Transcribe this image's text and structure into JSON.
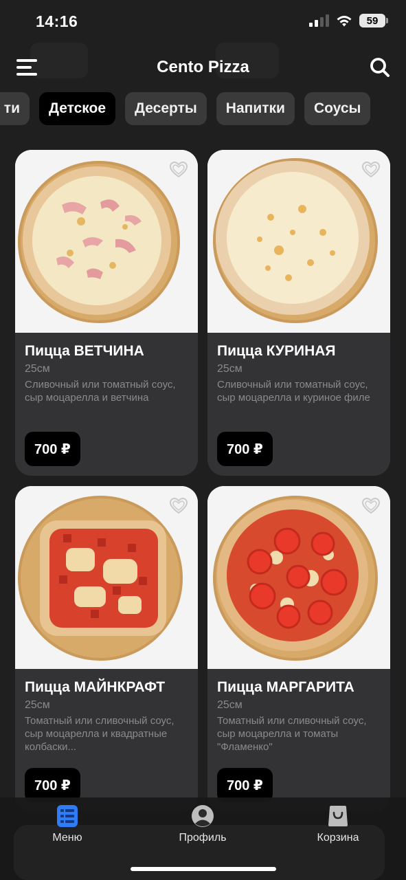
{
  "status": {
    "time": "14:16",
    "battery": "59"
  },
  "header": {
    "title": "Cento Pizza"
  },
  "categories": {
    "items": [
      {
        "label": "ти",
        "active": false
      },
      {
        "label": "Детское",
        "active": true
      },
      {
        "label": "Десерты",
        "active": false
      },
      {
        "label": "Напитки",
        "active": false
      },
      {
        "label": "Соусы",
        "active": false
      }
    ]
  },
  "products": [
    {
      "title": "Пицца ВЕТЧИНА",
      "size": "25см",
      "description": "Сливочный или томатный соус, сыр моцарелла и ветчина",
      "price": "700 ₽",
      "favorite": false,
      "image": "pizza-ham"
    },
    {
      "title": "Пицца КУРИНАЯ",
      "size": "25см",
      "description": "Сливочный или томатный соус, сыр моцарелла и куриное филе",
      "price": "700 ₽",
      "favorite": false,
      "image": "pizza-chicken"
    },
    {
      "title": "Пицца МАЙНКРАФТ",
      "size": "25см",
      "description": "Томатный или сливочный соус, сыр моцарелла и квадратные колбаски...",
      "price": "700 ₽",
      "favorite": false,
      "image": "pizza-minecraft"
    },
    {
      "title": "Пицца МАРГАРИТА",
      "size": "25см",
      "description": "Томатный или сливочный соус, сыр моцарелла и томаты \"Фламенко\"",
      "price": "700 ₽",
      "favorite": false,
      "image": "pizza-margherita"
    }
  ],
  "nav": {
    "menu": {
      "label": "Меню",
      "icon": "menu-list-icon",
      "color": "#2f7cf6",
      "active": true
    },
    "profile": {
      "label": "Профиль",
      "icon": "profile-icon",
      "active": false
    },
    "cart": {
      "label": "Корзина",
      "icon": "shopping-bag-icon",
      "active": false
    }
  },
  "colors": {
    "background": "#1f1f1f",
    "card": "#333335",
    "chip": "#3a3a3a",
    "active_chip": "#000000",
    "accent": "#2f7cf6"
  }
}
